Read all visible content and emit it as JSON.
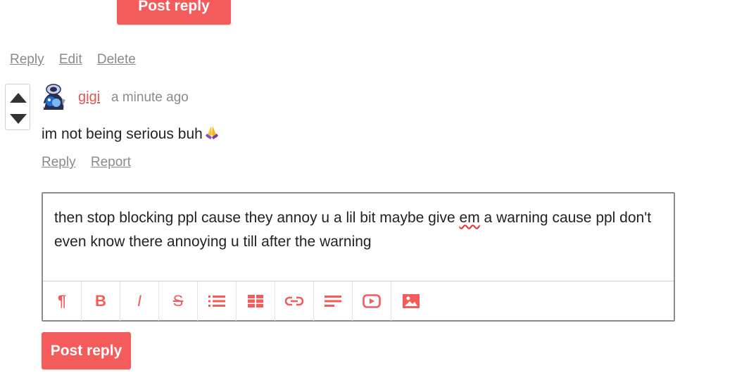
{
  "previous": {
    "post_reply_label": "Post reply",
    "actions": {
      "reply": "Reply",
      "edit": "Edit",
      "delete": "Delete"
    }
  },
  "comment": {
    "author": "gigi",
    "timestamp": "a minute ago",
    "body": "im not being serious buh",
    "emoji": "folded-hands-emoji",
    "actions": {
      "reply": "Reply",
      "report": "Report"
    }
  },
  "editor": {
    "text_before": "then stop blocking ppl cause they annoy u a lil bit maybe give ",
    "misspelled": "em",
    "text_after": " a warning cause ppl don't even know there annoying u till after the warning",
    "toolbar": [
      "paragraph-icon",
      "bold-icon",
      "italic-icon",
      "strikethrough-icon",
      "bulleted-list-icon",
      "table-icon",
      "link-icon",
      "align-icon",
      "video-icon",
      "image-icon"
    ],
    "toolbar_glyphs": {
      "paragraph": "¶",
      "bold": "B",
      "italic": "I",
      "strike": "S"
    }
  },
  "post_reply_label": "Post reply",
  "colors": {
    "accent": "#f45b5b",
    "author": "#e25555",
    "muted": "#8a8a8a"
  }
}
